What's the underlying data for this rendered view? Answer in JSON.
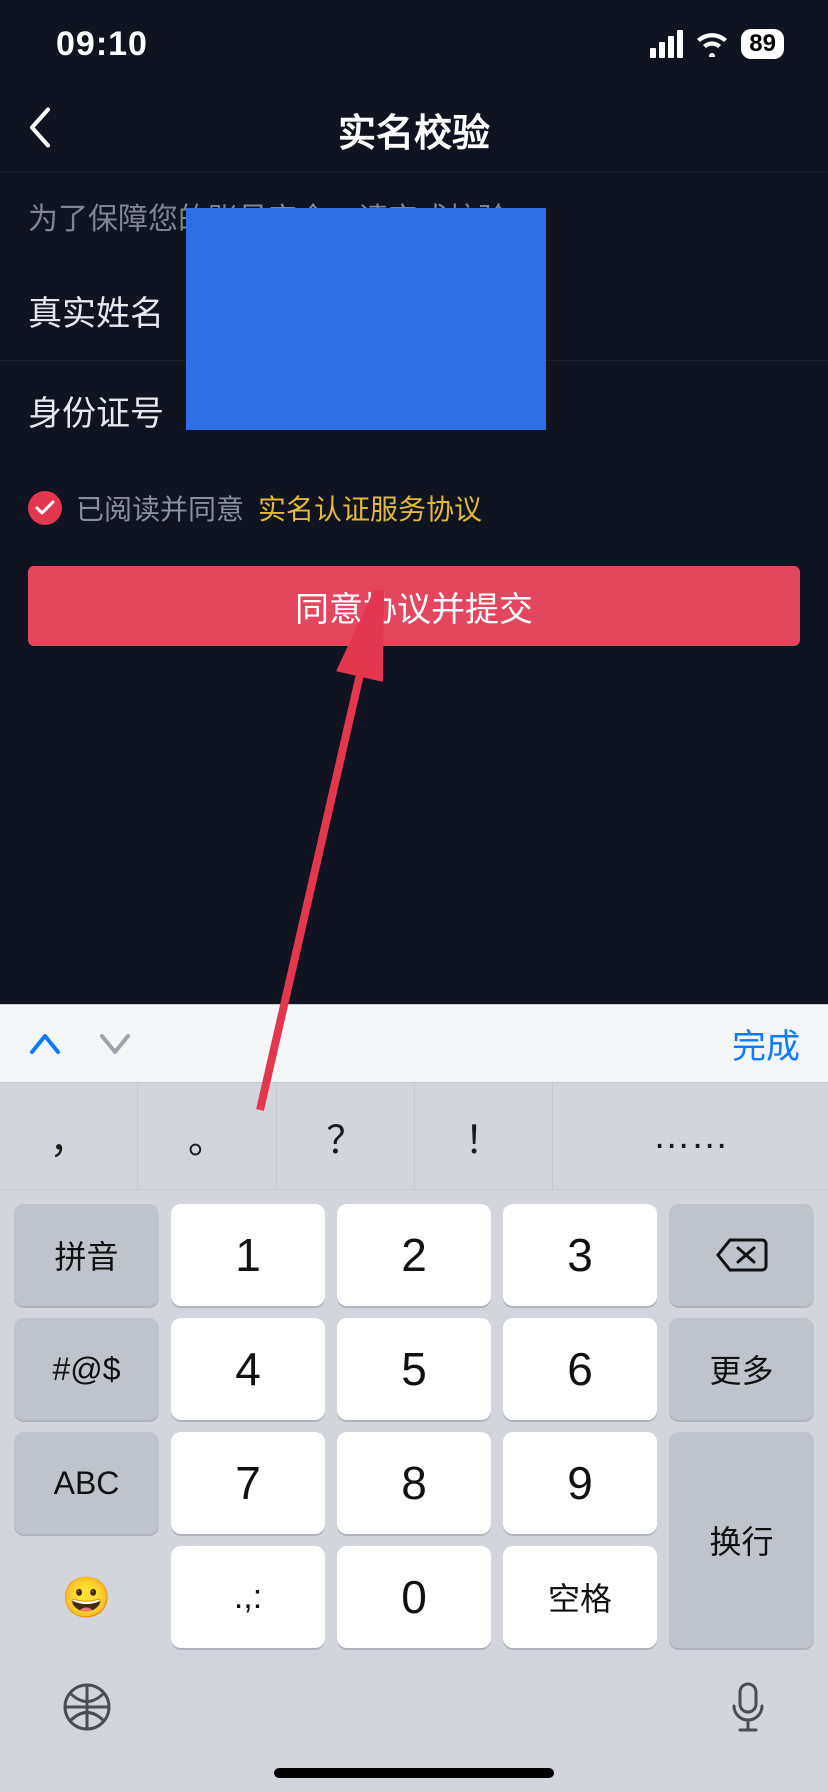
{
  "status": {
    "time": "09:10",
    "battery": "89"
  },
  "nav": {
    "title": "实名校验"
  },
  "intro": "为了保障您的账号安全，请完成校验",
  "fields": {
    "name_label": "真实姓名",
    "id_label": "身份证号"
  },
  "agree": {
    "text": "已阅读并同意",
    "link": "实名认证服务协议"
  },
  "submit": {
    "label": "同意协议并提交"
  },
  "keyboard": {
    "done": "完成",
    "punct": [
      "，",
      "。",
      "？",
      "！",
      "……"
    ],
    "side_left": [
      "拼音",
      "#@$",
      "ABC",
      "😀"
    ],
    "digits_r1": [
      "1",
      "2",
      "3"
    ],
    "digits_r2": [
      "4",
      "5",
      "6"
    ],
    "digits_r3": [
      "7",
      "8",
      "9"
    ],
    "bottom": [
      ".,:",
      "0",
      "空格"
    ],
    "side_right_top": "⌫",
    "side_right_mid": "更多",
    "side_right_bottom": "换行"
  }
}
